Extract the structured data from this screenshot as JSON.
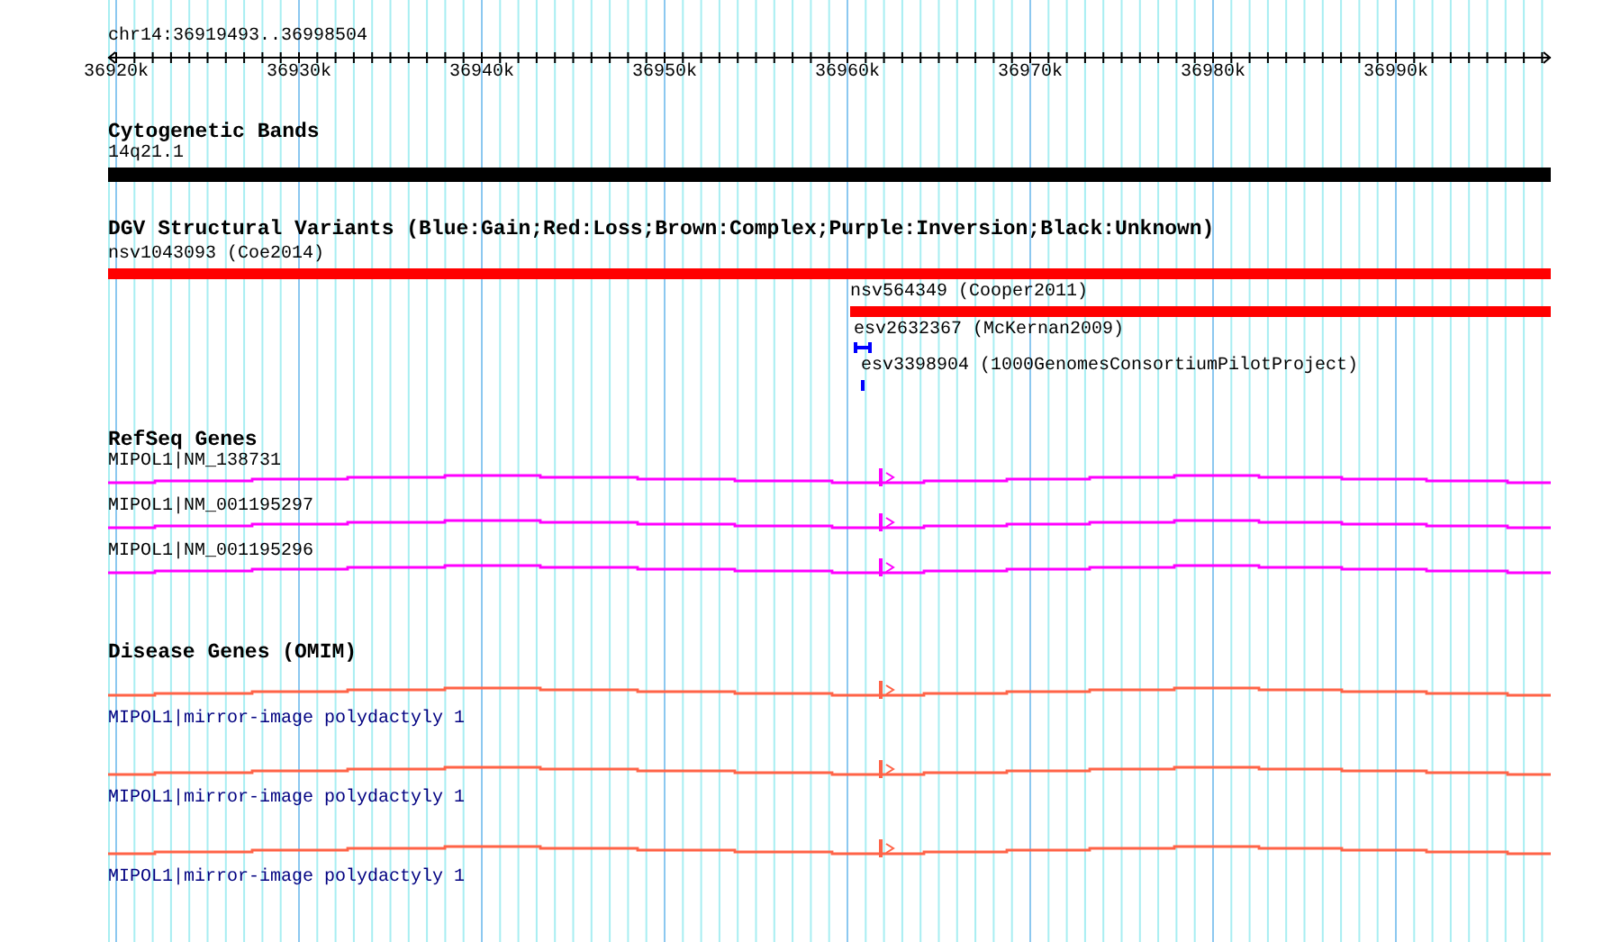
{
  "ruler": {
    "region": "chr14:36919493..36998504",
    "ticks": [
      "36920k",
      "36930k",
      "36940k",
      "36950k",
      "36960k",
      "36970k",
      "36980k",
      "36990k"
    ]
  },
  "tracks": [
    {
      "kind": "band",
      "title": "Cytogenetic Bands",
      "features": [
        {
          "label": "14q21.1"
        }
      ]
    },
    {
      "kind": "variants",
      "title": "DGV Structural Variants (Blue:Gain;Red:Loss;Brown:Complex;Purple:Inversion;Black:Unknown)",
      "features": [
        {
          "label": "nsv1043093 (Coe2014)",
          "color": "#ff0000"
        },
        {
          "label": "nsv564349 (Cooper2011)",
          "color": "#ff0000"
        },
        {
          "label": "esv2632367 (McKernan2009)",
          "color": "#0000ff"
        },
        {
          "label": "esv3398904 (1000GenomesConsortiumPilotProject)",
          "color": "#0000ff"
        }
      ]
    },
    {
      "kind": "genes",
      "title": "RefSeq Genes",
      "color": "#ff00ff",
      "features": [
        {
          "label": "MIPOL1|NM_138731"
        },
        {
          "label": "MIPOL1|NM_001195297"
        },
        {
          "label": "MIPOL1|NM_001195296"
        }
      ]
    },
    {
      "kind": "disease_genes",
      "title": "Disease Genes (OMIM)",
      "color": "#ff6347",
      "features": [
        {
          "label": "MIPOL1|mirror-image polydactyly 1"
        },
        {
          "label": "MIPOL1|mirror-image polydactyly 1"
        },
        {
          "label": "MIPOL1|mirror-image polydactyly 1"
        }
      ]
    }
  ]
}
